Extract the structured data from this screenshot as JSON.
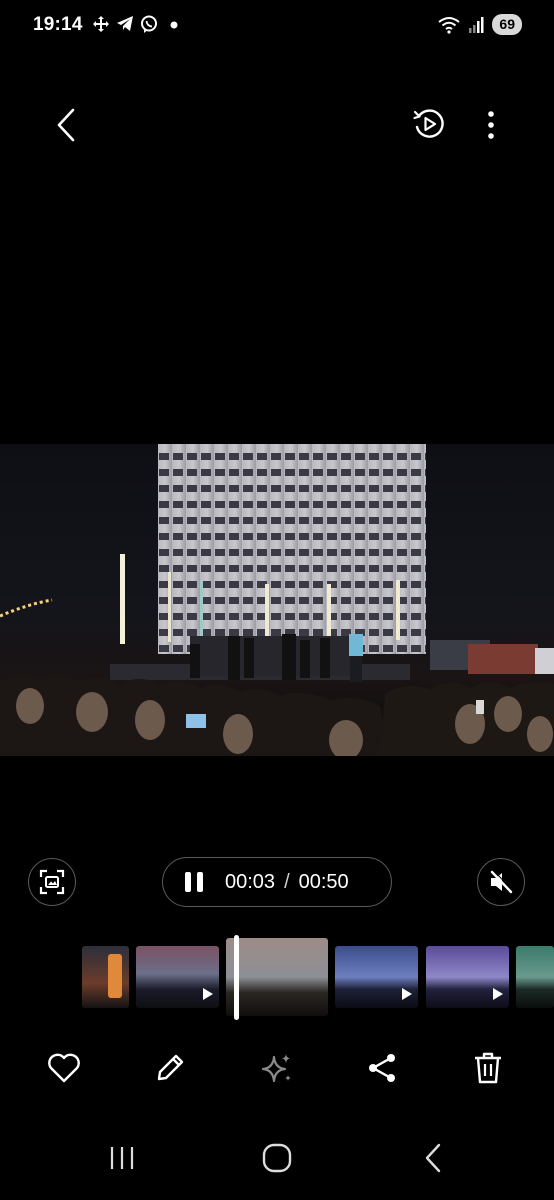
{
  "status_bar": {
    "time": "19:14",
    "battery": "69",
    "left_icons": [
      "move-icon",
      "telegram-icon",
      "viber-icon",
      "dot-icon"
    ],
    "right_icons": [
      "wifi-icon",
      "signal-icon",
      "battery-icon"
    ]
  },
  "top_bar": {
    "back_icon": "back-arrow-icon",
    "icons": [
      "motion-photo-icon",
      "more-options-icon"
    ]
  },
  "video": {
    "scene": "outdoor-night-concert-photo"
  },
  "player": {
    "current_time": "00:03",
    "separator": "/",
    "total_time": "00:50",
    "state": "playing",
    "muted": true,
    "progress": 0.06
  },
  "filmstrip": {
    "thumbnail_count": 6
  },
  "actions": [
    "favorite-icon",
    "edit-icon",
    "ai-enhance-icon",
    "share-icon",
    "delete-icon"
  ],
  "nav_bar": [
    "recents-icon",
    "home-icon",
    "back-icon"
  ],
  "colors": {
    "background": "#000000",
    "control_border": "#5a5a5a",
    "ai_icon_disabled": "#8a8a8a"
  }
}
